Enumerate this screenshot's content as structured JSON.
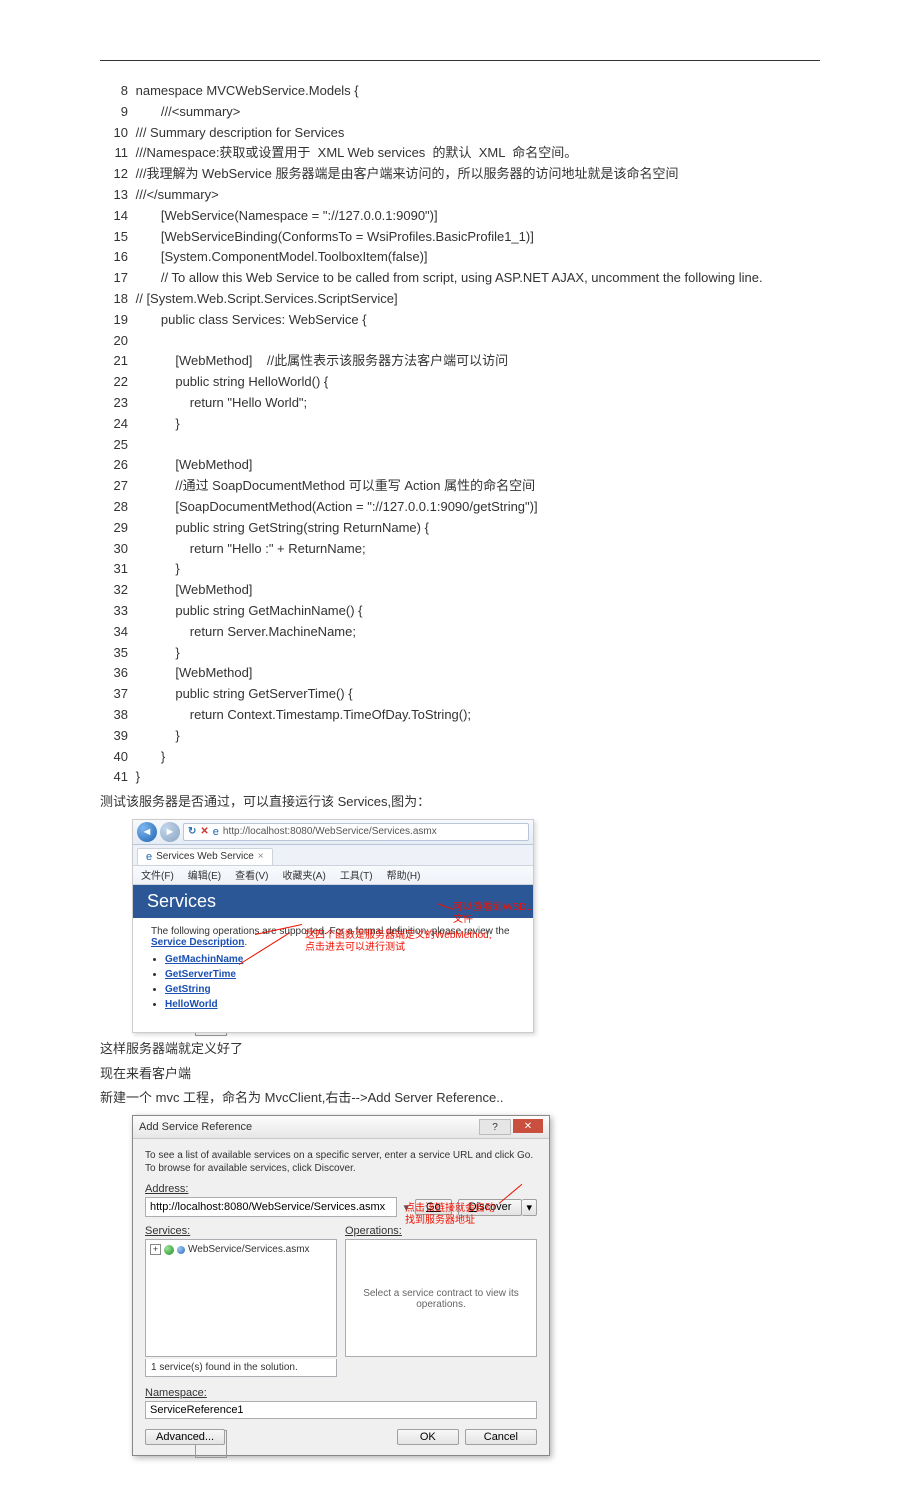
{
  "lines": [
    {
      "n": "8",
      "t": " namespace MVCWebService.Models {"
    },
    {
      "n": "9",
      "t": "        ///<summary>"
    },
    {
      "n": "10",
      "t": " /// Summary description for Services"
    },
    {
      "n": "11",
      "t": " ///Namespace:获取或设置用于  XML Web services  的默认  XML  命名空间。"
    },
    {
      "n": "12",
      "t": " ///我理解为 WebService 服务器端是由客户端来访问的，所以服务器的访问地址就是该命名空间"
    },
    {
      "n": "13",
      "t": " ///</summary>"
    },
    {
      "n": "14",
      "t": "        [WebService(Namespace = \"://127.0.0.1:9090\")]"
    },
    {
      "n": "15",
      "t": "        [WebServiceBinding(ConformsTo = WsiProfiles.BasicProfile1_1)]"
    },
    {
      "n": "16",
      "t": "        [System.ComponentModel.ToolboxItem(false)]"
    },
    {
      "n": "17",
      "t": "        // To allow this Web Service to be called from script, using ASP.NET AJAX, uncomment the following line."
    },
    {
      "n": "18",
      "t": " // [System.Web.Script.Services.ScriptService]"
    },
    {
      "n": "19",
      "t": "        public class Services: WebService {"
    },
    {
      "n": "20",
      "t": ""
    },
    {
      "n": "21",
      "t": "            [WebMethod]    //此属性表示该服务器方法客户端可以访问"
    },
    {
      "n": "22",
      "t": "            public string HelloWorld() {"
    },
    {
      "n": "23",
      "t": "                return \"Hello World\";"
    },
    {
      "n": "24",
      "t": "            }"
    },
    {
      "n": "25",
      "t": ""
    },
    {
      "n": "26",
      "t": "            [WebMethod]"
    },
    {
      "n": "27",
      "t": "            //通过 SoapDocumentMethod 可以重写 Action 属性的命名空间"
    },
    {
      "n": "28",
      "t": "            [SoapDocumentMethod(Action = \"://127.0.0.1:9090/getString\")]"
    },
    {
      "n": "29",
      "t": "            public string GetString(string ReturnName) {"
    },
    {
      "n": "30",
      "t": "                return \"Hello :\" + ReturnName;"
    },
    {
      "n": "31",
      "t": "            }"
    },
    {
      "n": "32",
      "t": "            [WebMethod]"
    },
    {
      "n": "33",
      "t": "            public string GetMachinName() {"
    },
    {
      "n": "34",
      "t": "                return Server.MachineName;"
    },
    {
      "n": "35",
      "t": "            }"
    },
    {
      "n": "36",
      "t": "            [WebMethod]"
    },
    {
      "n": "37",
      "t": "            public string GetServerTime() {"
    },
    {
      "n": "38",
      "t": "                return Context.Timestamp.TimeOfDay.ToString();"
    },
    {
      "n": "39",
      "t": "            }"
    },
    {
      "n": "40",
      "t": "        }"
    },
    {
      "n": "41",
      "t": " }"
    }
  ],
  "para1": "测试该服务器是否通过，可以直接运行该 Services,图为：",
  "browser": {
    "url": "http://localhost:8080/WebService/Services.asmx",
    "tab_title": "Services Web Service",
    "menus": [
      "文件(F)",
      "编辑(E)",
      "查看(V)",
      "收藏夹(A)",
      "工具(T)",
      "帮助(H)"
    ],
    "header": "Services",
    "intro_a": "The following operations are supported. For a formal definition, please review the ",
    "intro_link": "Service Description",
    "ops": [
      "GetMachinName",
      "GetServerTime",
      "GetString",
      "HelloWorld"
    ],
    "anno1": "可以查看到WSDL文件",
    "anno2a": "这四个函数是服务器端定义的WebMethod,",
    "anno2b": "点击进去可以进行测试"
  },
  "para2": "这样服务器端就定义好了",
  "para3": "现在来看客户端",
  "para4": "新建一个 mvc 工程，命名为 MvcClient,右击-->Add Server Reference..",
  "dialog": {
    "title": "Add Service Reference",
    "hint": "To see a list of available services on a specific server, enter a service URL and click Go. To browse for available services, click Discover.",
    "address_label": "Address:",
    "address_value": "http://localhost:8080/WebService/Services.asmx",
    "go": "Go",
    "discover": "Discover",
    "services_label": "Services:",
    "operations_label": "Operations:",
    "tree_item": "WebService/Services.asmx",
    "ops_msg": "Select a service contract to view its operations.",
    "found": "1 service(s) found in the solution.",
    "namespace_label": "Namespace:",
    "namespace_value": "ServiceReference1",
    "advanced": "Advanced...",
    "ok": "OK",
    "cancel": "Cancel",
    "anno_a": "点击该链接就会自动",
    "anno_b": "找到服务器地址"
  }
}
